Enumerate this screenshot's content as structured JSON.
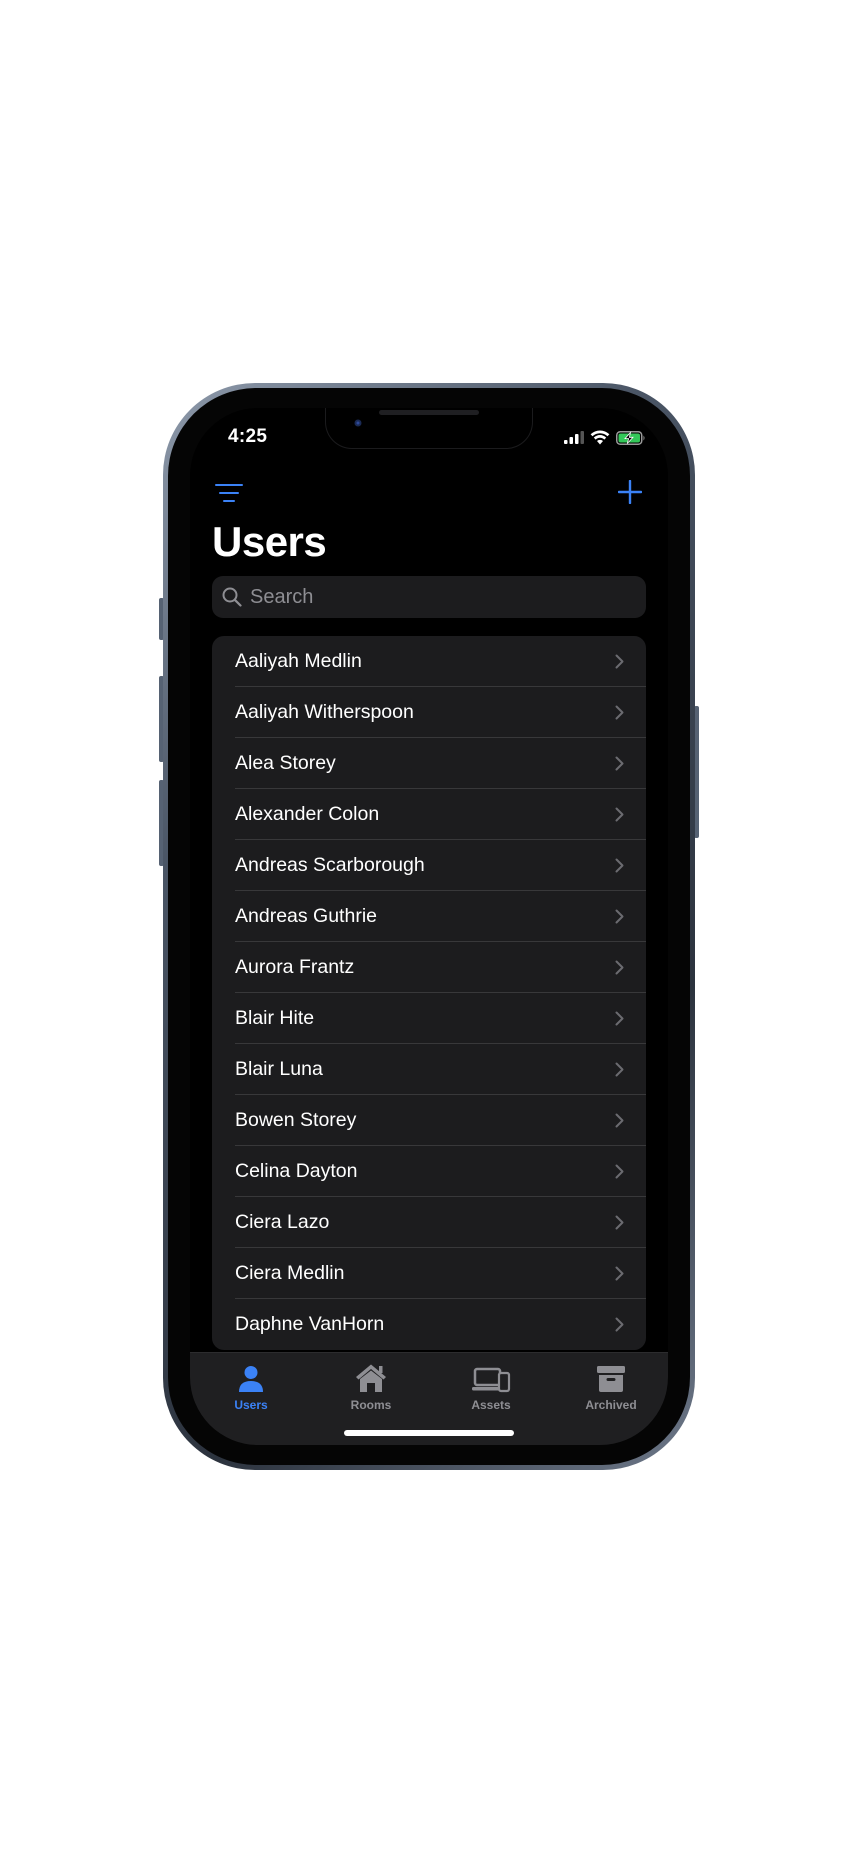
{
  "status_bar": {
    "time": "4:25",
    "icons": [
      "cellular-signal-icon",
      "wifi-icon",
      "battery-charging-icon"
    ]
  },
  "nav": {
    "title": "Users",
    "left_icon": "filter-lines-icon",
    "right_icon": "plus-icon"
  },
  "search": {
    "placeholder": "Search",
    "value": ""
  },
  "users": [
    "Aaliyah Medlin",
    "Aaliyah Witherspoon",
    "Alea Storey",
    "Alexander Colon",
    "Andreas Scarborough",
    "Andreas Guthrie",
    "Aurora Frantz",
    "Blair Hite",
    "Blair Luna",
    "Bowen Storey",
    "Celina Dayton",
    "Ciera Lazo",
    "Ciera Medlin",
    "Daphne VanHorn"
  ],
  "tab_bar": {
    "tabs": [
      {
        "label": "Users",
        "icon": "person-icon",
        "active": true
      },
      {
        "label": "Rooms",
        "icon": "house-icon",
        "active": false
      },
      {
        "label": "Assets",
        "icon": "laptop-phone-icon",
        "active": false
      },
      {
        "label": "Archived",
        "icon": "archive-box-icon",
        "active": false
      }
    ]
  },
  "colors": {
    "accent": "#3b82f6",
    "background": "#000000",
    "surface": "#1c1c1e",
    "separator": "#38383a",
    "inactive": "#8e8e93",
    "tab_bar": "#1f1f21"
  }
}
